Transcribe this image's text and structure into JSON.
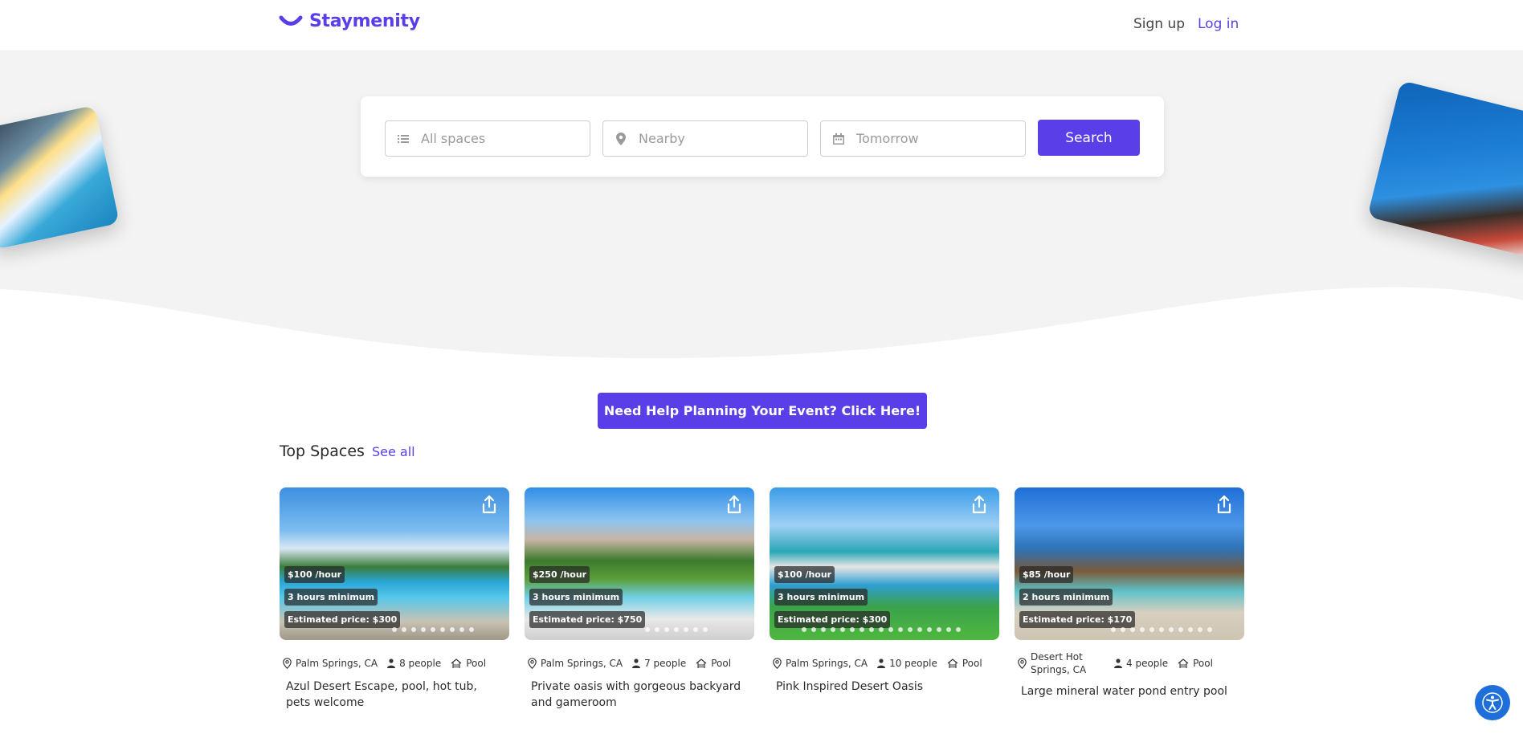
{
  "header": {
    "brand": "Staymenity",
    "signup_label": "Sign up",
    "login_label": "Log in"
  },
  "search": {
    "space_placeholder": "All spaces",
    "location_placeholder": "Nearby",
    "date_placeholder": "Tomorrow",
    "button_label": "Search"
  },
  "cta": {
    "label": "Need Help Planning Your Event? Click Here!"
  },
  "section": {
    "title": "Top Spaces",
    "see_all": "See all"
  },
  "cards": [
    {
      "price": "$100 /hour",
      "minimum": "3 hours minimum",
      "estimate": "Estimated price: $300",
      "location": "Palm Springs, CA",
      "people": "8 people",
      "type": "Pool",
      "title": "Azul Desert Escape, pool, hot tub, pets welcome"
    },
    {
      "price": "$250 /hour",
      "minimum": "3 hours minimum",
      "estimate": "Estimated price: $750",
      "location": "Palm Springs, CA",
      "people": "7 people",
      "type": "Pool",
      "title": "Private oasis with gorgeous backyard and gameroom"
    },
    {
      "price": "$100 /hour",
      "minimum": "3 hours minimum",
      "estimate": "Estimated price: $300",
      "location": "Palm Springs, CA",
      "people": "10 people",
      "type": "Pool",
      "title": "Pink Inspired Desert Oasis"
    },
    {
      "price": "$85 /hour",
      "minimum": "2 hours minimum",
      "estimate": "Estimated price: $170",
      "location": "Desert Hot Springs, CA",
      "people": "4 people",
      "type": "Pool",
      "title": "Large mineral water pond entry pool"
    }
  ],
  "colors": {
    "brand": "#5a3ee8",
    "accessibility": "#1e6fd9",
    "hero_bg": "#f3f3f3"
  },
  "icons": [
    "smile-logo-icon",
    "list-icon",
    "location-pin-icon",
    "calendar-icon",
    "share-icon",
    "map-pin-icon",
    "person-icon",
    "pool-icon",
    "accessibility-icon"
  ]
}
